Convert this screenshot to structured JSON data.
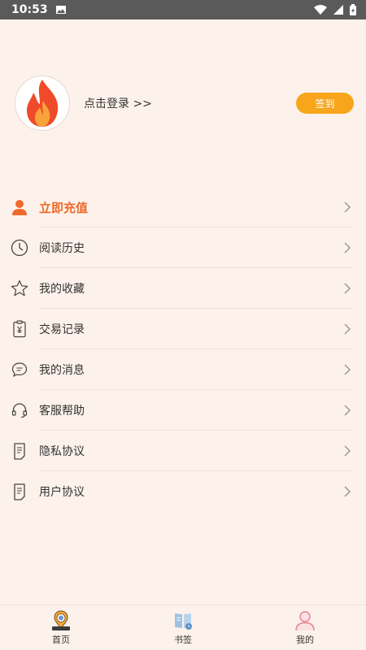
{
  "status_bar": {
    "time": "10:53"
  },
  "profile": {
    "login_text": "点击登录 >>",
    "checkin_label": "签到"
  },
  "menu": {
    "items": [
      {
        "label": "立即充值",
        "icon": "user-icon"
      },
      {
        "label": "阅读历史",
        "icon": "clock-icon"
      },
      {
        "label": "我的收藏",
        "icon": "star-icon"
      },
      {
        "label": "交易记录",
        "icon": "receipt-icon"
      },
      {
        "label": "我的消息",
        "icon": "message-icon"
      },
      {
        "label": "客服帮助",
        "icon": "headset-icon"
      },
      {
        "label": "隐私协议",
        "icon": "document-icon"
      },
      {
        "label": "用户协议",
        "icon": "document-icon"
      }
    ]
  },
  "tabbar": {
    "tabs": [
      {
        "label": "首页",
        "icon": "home-icon"
      },
      {
        "label": "书签",
        "icon": "bookmark-icon"
      },
      {
        "label": "我的",
        "icon": "profile-icon"
      }
    ]
  },
  "colors": {
    "accent": "#ee6a2c",
    "button": "#f7a51b",
    "background": "#fdf2eb"
  }
}
